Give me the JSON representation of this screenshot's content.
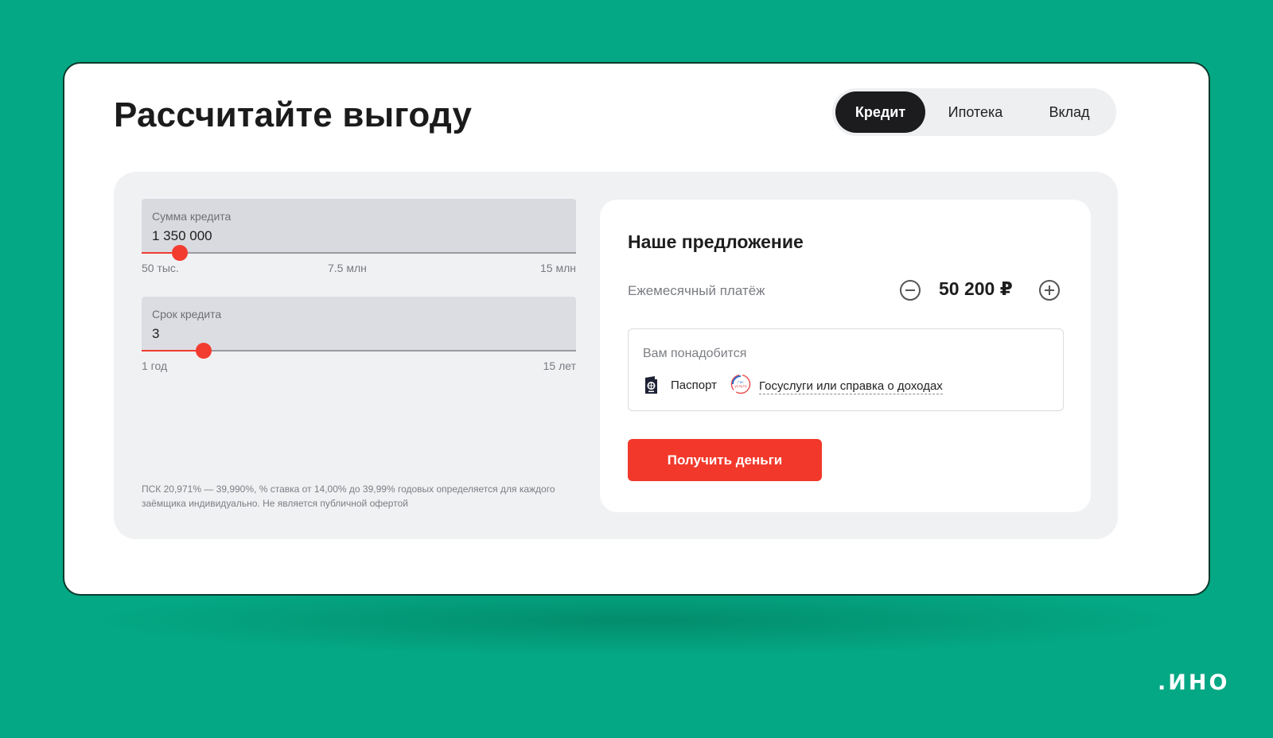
{
  "title": "Рассчитайте выгоду",
  "tabs": [
    {
      "label": "Кредит",
      "active": true
    },
    {
      "label": "Ипотека",
      "active": false
    },
    {
      "label": "Вклад",
      "active": false
    }
  ],
  "calculator": {
    "amount": {
      "label": "Сумма кредита",
      "value": "1 350 000",
      "slider_fraction": 0.088,
      "ticks": [
        "50 тыс.",
        "7.5 млн",
        "15 млн"
      ]
    },
    "term": {
      "label": "Срок кредита",
      "value": "3",
      "slider_fraction": 0.143,
      "ticks": [
        "1 год",
        "15 лет"
      ]
    },
    "disclaimer": "ПСК 20,971% — 39,990%, % ставка от 14,00% до 39,99% годовых определяется для каждого заёмщика индивидуально. Не является публичной офертой"
  },
  "offer": {
    "title": "Наше предложение",
    "payment_label": "Ежемесячный платёж",
    "payment_value": "50 200 ₽",
    "needs_label": "Вам понадобится",
    "doc_passport": "Паспорт",
    "doc_gos": "Госуслуги или справка о доходах",
    "gos_icon_text": "гос услуги",
    "cta_label": "Получить деньги"
  },
  "brand": ".ИНО",
  "colors": {
    "background": "#04a884",
    "accent": "#f2382b",
    "dark": "#1c1c1e"
  },
  "icons": [
    "minus-circle-icon",
    "plus-circle-icon",
    "passport-icon",
    "gosuslugi-icon"
  ]
}
